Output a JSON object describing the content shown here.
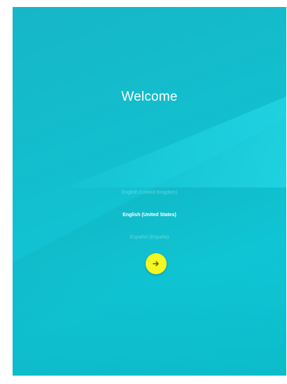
{
  "welcome": {
    "title": "Welcome"
  },
  "languages": [
    {
      "label": "English (United Kingdom)",
      "selected": false
    },
    {
      "label": "English (United States)",
      "selected": true
    },
    {
      "label": "Español (España)",
      "selected": false
    }
  ],
  "next_button": {
    "icon": "arrow-right-icon",
    "color": "#f4f724"
  },
  "colors": {
    "background": "#12c0cf",
    "accent": "#f4f724"
  }
}
